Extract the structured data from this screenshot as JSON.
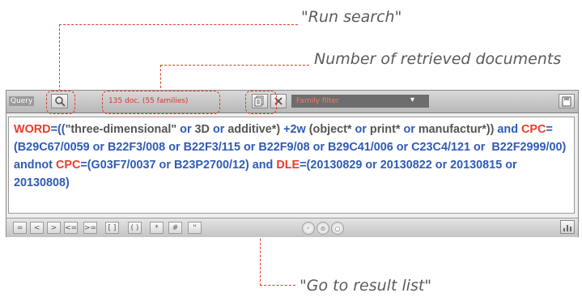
{
  "annotations": {
    "run_search": "\"Run search\"",
    "retrieved_docs": "Number of retrieved documents",
    "go_to_results": "\"Go to result list\""
  },
  "toolbar": {
    "query_label": "Query",
    "search_icon": "search-icon",
    "doc_count": "135 doc. (55 families)",
    "result_list_icon": "result-list-icon",
    "clear_icon": "close-icon",
    "family_filter": "Family filter",
    "save_icon": "save-icon"
  },
  "query": {
    "segments": [
      {
        "t": "WORD",
        "c": "fld"
      },
      {
        "t": "=((",
        "c": "op"
      },
      {
        "t": "\"three-dimensional\"",
        "c": "txt"
      },
      {
        "t": " or ",
        "c": "op"
      },
      {
        "t": "3D",
        "c": "txt"
      },
      {
        "t": " or ",
        "c": "op"
      },
      {
        "t": "additive*)",
        "c": "txt"
      },
      {
        "t": " +2w ",
        "c": "op"
      },
      {
        "t": "(object*",
        "c": "txt"
      },
      {
        "t": " or ",
        "c": "op"
      },
      {
        "t": "print*",
        "c": "txt"
      },
      {
        "t": " or ",
        "c": "op"
      },
      {
        "t": "manufactur*)) ",
        "c": "txt"
      },
      {
        "t": "and ",
        "c": "op"
      },
      {
        "t": "CPC",
        "c": "fld"
      },
      {
        "t": "=(B29C67/0059 or B22F3/008 or B22F3/115 or B22F9/08 or B29C41/006 or C23C4/121 or  B22F2999/00) andnot ",
        "c": "op"
      },
      {
        "t": "CPC",
        "c": "fld"
      },
      {
        "t": "=(G03F7/0037 or B23P2700/12) and ",
        "c": "op"
      },
      {
        "t": "DLE",
        "c": "fld"
      },
      {
        "t": "=(20130829 or 20130822 or 20130815 or 20130808)",
        "c": "op"
      }
    ]
  },
  "operators": [
    "=",
    "<",
    ">",
    "<=",
    ">=",
    "[ ]",
    "( )",
    "*",
    "#",
    "\""
  ],
  "bottom_icons": [
    "search-field-icon",
    "multi-field-icon",
    "clear-field-icon"
  ],
  "bottom_right_icon": "stats-icon",
  "colors": {
    "annotation_line": "#e03a2a",
    "field": "#ee3b2b",
    "operator": "#2f5bb7"
  }
}
